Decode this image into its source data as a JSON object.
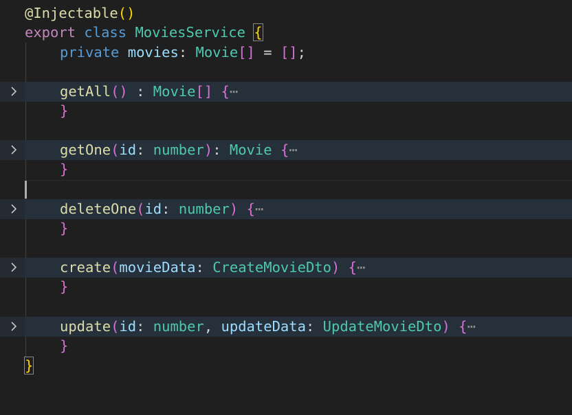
{
  "editor": {
    "language": "typescript",
    "colors": {
      "background": "#1f1f1f",
      "keyword": "#c586c0",
      "storage": "#569cd6",
      "type": "#4ec9b0",
      "function": "#dcdcaa",
      "variable": "#9cdcfe",
      "bracket1": "#ffd700",
      "bracket2": "#da70d6",
      "bracket3": "#179fff"
    },
    "lines": {
      "l1": {
        "decorator": "@Injectable",
        "open": "(",
        "close": ")"
      },
      "l2": {
        "export_kw": "export",
        "class_kw": "class",
        "class_name": "MoviesService",
        "brace": "{"
      },
      "l3": {
        "private_kw": "private",
        "prop": "movies",
        "colon": ":",
        "type": "Movie",
        "arr": "[]",
        "eq": "=",
        "value": "[]",
        "semi": ";"
      },
      "l5": {
        "name": "getAll",
        "params_open": "(",
        "params_close": ")",
        "ret_colon": " :",
        "ret_type": "Movie",
        "ret_arr": "[]",
        "brace": "{",
        "folded": "⋯",
        "close": "}"
      },
      "l8": {
        "name": "getOne",
        "params_open": "(",
        "param1": "id",
        "colon1": ":",
        "ptype1": "number",
        "params_close": ")",
        "ret_colon": ":",
        "ret_type": "Movie",
        "brace": "{",
        "folded": "⋯",
        "close": "}"
      },
      "l11": {
        "name": "deleteOne",
        "params_open": "(",
        "param1": "id",
        "colon1": ":",
        "ptype1": "number",
        "params_close": ")",
        "brace": "{",
        "folded": "⋯",
        "close": "}"
      },
      "l14": {
        "name": "create",
        "params_open": "(",
        "param1": "movieData",
        "colon1": ":",
        "ptype1": "CreateMovieDto",
        "params_close": ")",
        "brace": "{",
        "folded": "⋯",
        "close": "}"
      },
      "l17": {
        "name": "update",
        "params_open": "(",
        "param1": "id",
        "colon1": ":",
        "ptype1": "number",
        "comma": ",",
        "param2": "updateData",
        "colon2": ":",
        "ptype2": "UpdateMovieDto",
        "params_close": ")",
        "brace": "{",
        "folded": "⋯",
        "close": "}"
      },
      "l19": {
        "brace": "}"
      }
    }
  }
}
